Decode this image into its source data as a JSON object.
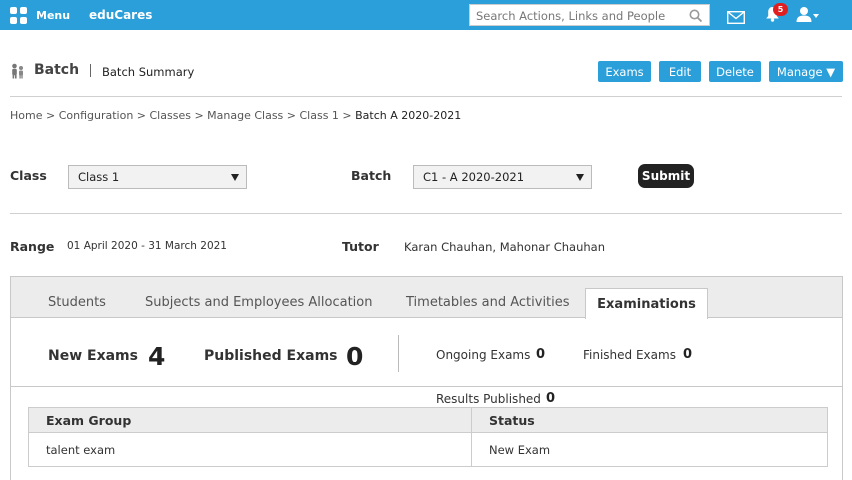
{
  "topbar": {
    "menu_label": "Menu",
    "app_name": "eduCares",
    "search_placeholder": "Search Actions, Links and People",
    "notification_count": "5",
    "background": "#2b9fd9"
  },
  "header": {
    "title": "Batch",
    "subtitle": "Batch Summary",
    "actions": {
      "exams": "Exams",
      "edit": "Edit",
      "delete": "Delete",
      "manage": "Manage ▼"
    }
  },
  "breadcrumb": {
    "trail": "Home > Configuration > Classes > Manage Class > Class 1 >",
    "current": "Batch A 2020-2021"
  },
  "filters": {
    "class_label": "Class",
    "class_value": "Class 1",
    "batch_label": "Batch",
    "batch_value": "C1 - A 2020-2021",
    "submit_label": "Submit"
  },
  "info": {
    "range_label": "Range",
    "range_value": "01 April 2020 - 31 March 2021",
    "tutor_label": "Tutor",
    "tutor_value": "Karan Chauhan, Mahonar Chauhan"
  },
  "tabs": [
    {
      "label": "Students"
    },
    {
      "label": "Subjects and Employees Allocation"
    },
    {
      "label": "Timetables and Activities"
    },
    {
      "label": "Examinations"
    }
  ],
  "active_tab": "Examinations",
  "stats": {
    "new_exams_label": "New Exams",
    "new_exams_value": "4",
    "published_exams_label": "Published Exams",
    "published_exams_value": "0",
    "ongoing_label": "Ongoing Exams",
    "ongoing_value": "0",
    "finished_label": "Finished Exams",
    "finished_value": "0",
    "results_published_label": "Results Published",
    "results_published_value": "0"
  },
  "table": {
    "headers": [
      "Exam Group",
      "Status"
    ],
    "rows": [
      [
        "talent exam",
        "New Exam"
      ]
    ]
  }
}
